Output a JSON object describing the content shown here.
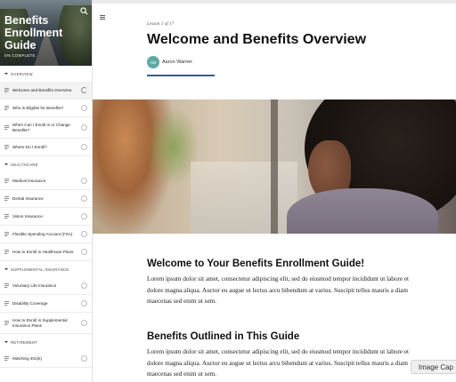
{
  "course": {
    "title": "Benefits Enrollment Guide",
    "progress_label": "0% COMPLETE"
  },
  "sidebar": {
    "sections": [
      {
        "heading": "OVERVIEW",
        "lessons": [
          {
            "label": "Welcome and Benefits Overview",
            "current": true
          },
          {
            "label": "Who is Eligible for Benefits?"
          },
          {
            "label": "When Can I Enroll in or Change Benefits?"
          },
          {
            "label": "Where Do I Enroll?"
          }
        ]
      },
      {
        "heading": "HEALTHCARE",
        "lessons": [
          {
            "label": "Medical Insurance"
          },
          {
            "label": "Dental Insurance"
          },
          {
            "label": "Vision Insurance"
          },
          {
            "label": "Flexible Spending Account (FSA)"
          },
          {
            "label": "How to Enroll in Healthcare Plans"
          }
        ]
      },
      {
        "heading": "SUPPLEMENTAL INSURANCE",
        "lessons": [
          {
            "label": "Voluntary Life Insurance"
          },
          {
            "label": "Disability Coverage"
          },
          {
            "label": "How to Enroll in Supplemental Insurance Plans"
          }
        ]
      },
      {
        "heading": "RETIREMENT",
        "lessons": [
          {
            "label": "Matching 401(k)"
          }
        ]
      }
    ]
  },
  "main": {
    "lesson_count": "Lesson 1 of 17",
    "title": "Welcome and Benefits Overview",
    "author_initials": "AW",
    "author_name": "Aaron Warner",
    "section1_heading": "Welcome to Your Benefits Enrollment Guide!",
    "section1_body": "Lorem ipsum dolor sit amet, consectetur adipiscing elit, sed do eiusmod tempor incididunt ut labore et dolore magna aliqua. Auctor eu augue ut lectus arcu bibendum at varius. Suscipit tellus mauris a diam maecenas sed enim ut sem.",
    "section2_heading": "Benefits Outlined in This Guide",
    "section2_body": "Lorem ipsum dolor sit amet, consectetur adipiscing elit, sed do eiusmod tempor incididunt ut labore et dolore magna aliqua. Auctor eu augue ut lectus arcu bibendum at varius. Suscipit tellus mauris a diam maecenas sed enim ut sem.",
    "caption_tab": "Image Cap"
  },
  "colors": {
    "accent": "#3a5a8c",
    "avatar": "#5fa9a4"
  }
}
